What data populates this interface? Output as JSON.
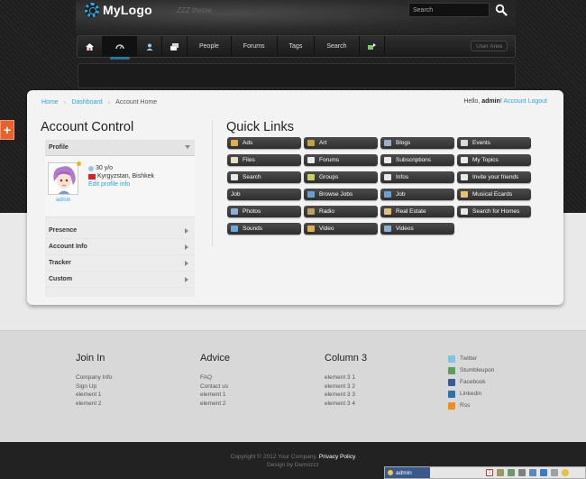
{
  "header": {
    "logo_text": "MyLogo",
    "theme_text": "ZZZ theme",
    "search_placeholder": "Search"
  },
  "nav": {
    "people": "People",
    "forums": "Forums",
    "tags": "Tags",
    "search": "Search",
    "user_area": "User Area"
  },
  "breadcrumb": {
    "home": "Home",
    "dashboard": "Dashboard",
    "current": "Account Home"
  },
  "greeting": {
    "prefix": "Hello, ",
    "user": "admin",
    "suffix": "! ",
    "logout": "Account Logout"
  },
  "account": {
    "title": "Account Control",
    "profile_label": "Profile",
    "age": "30 y/o",
    "location": "Kyrgyzstan, Bishkek",
    "edit_profile": "Edit profile info",
    "avatar_name": "admin",
    "sections": [
      "Presence",
      "Account Info",
      "Tracker",
      "Custom"
    ]
  },
  "quick_links": {
    "title": "Quick Links",
    "items": [
      {
        "label": "Ads",
        "color": "#e0b04a"
      },
      {
        "label": "Art",
        "color": "#c8a040"
      },
      {
        "label": "Blogs",
        "color": "#9ab0c8"
      },
      {
        "label": "Events",
        "color": "#d8d8d8"
      },
      {
        "label": "Files",
        "color": "#e8e0c0"
      },
      {
        "label": "Forums",
        "color": "#e8e8e8"
      },
      {
        "label": "Subscriptions",
        "color": "#e8e8e8"
      },
      {
        "label": "My Topics",
        "color": "#e8e8e8"
      },
      {
        "label": "Search",
        "color": "#e8e8e8"
      },
      {
        "label": "Groups",
        "color": "#c8d060"
      },
      {
        "label": "Infos",
        "color": "#e8e8e8"
      },
      {
        "label": "Invite your friends",
        "color": "#e8e8e8"
      },
      {
        "label": "Job",
        "color": ""
      },
      {
        "label": "Browse Jobs",
        "color": "#6aa0d0"
      },
      {
        "label": "Job",
        "color": "#6aa0d0"
      },
      {
        "label": "Musical Ecards",
        "color": "#e8c070"
      },
      {
        "label": "Photos",
        "color": "#8ab0d8"
      },
      {
        "label": "Radio",
        "color": "#c0a060"
      },
      {
        "label": "Real Estate",
        "color": "#e0c080"
      },
      {
        "label": "Search for Homes",
        "color": "#e8e8e8"
      },
      {
        "label": "Sounds",
        "color": "#6aa8e0"
      },
      {
        "label": "Video",
        "color": "#e0b050"
      },
      {
        "label": "Videos",
        "color": "#8ab0d8"
      }
    ]
  },
  "footer": {
    "columns": [
      {
        "title": "Join In",
        "links": [
          "Company Info",
          "Sign Up",
          "element 1",
          "element 2"
        ]
      },
      {
        "title": "Advice",
        "links": [
          "FAQ",
          "Contact us",
          "element 1",
          "element 2"
        ]
      },
      {
        "title": "Column 3",
        "links": [
          "element 3 1",
          "element 3 2",
          "element 3 3",
          "element 3 4"
        ]
      }
    ],
    "social": [
      {
        "label": "Twitter",
        "color": "#7fc4e8"
      },
      {
        "label": "Stumbleupon",
        "color": "#5aa05a"
      },
      {
        "label": "Facebook",
        "color": "#3b5998"
      },
      {
        "label": "Linkedin",
        "color": "#2a73b2"
      },
      {
        "label": "Rss",
        "color": "#f28c1e"
      }
    ],
    "copyright": "Copyright © 2012 Your Company.",
    "privacy": "Privacy Policy",
    "design": "Design by Demozzz"
  },
  "toolbar": {
    "user": "admin",
    "badge": "1"
  }
}
